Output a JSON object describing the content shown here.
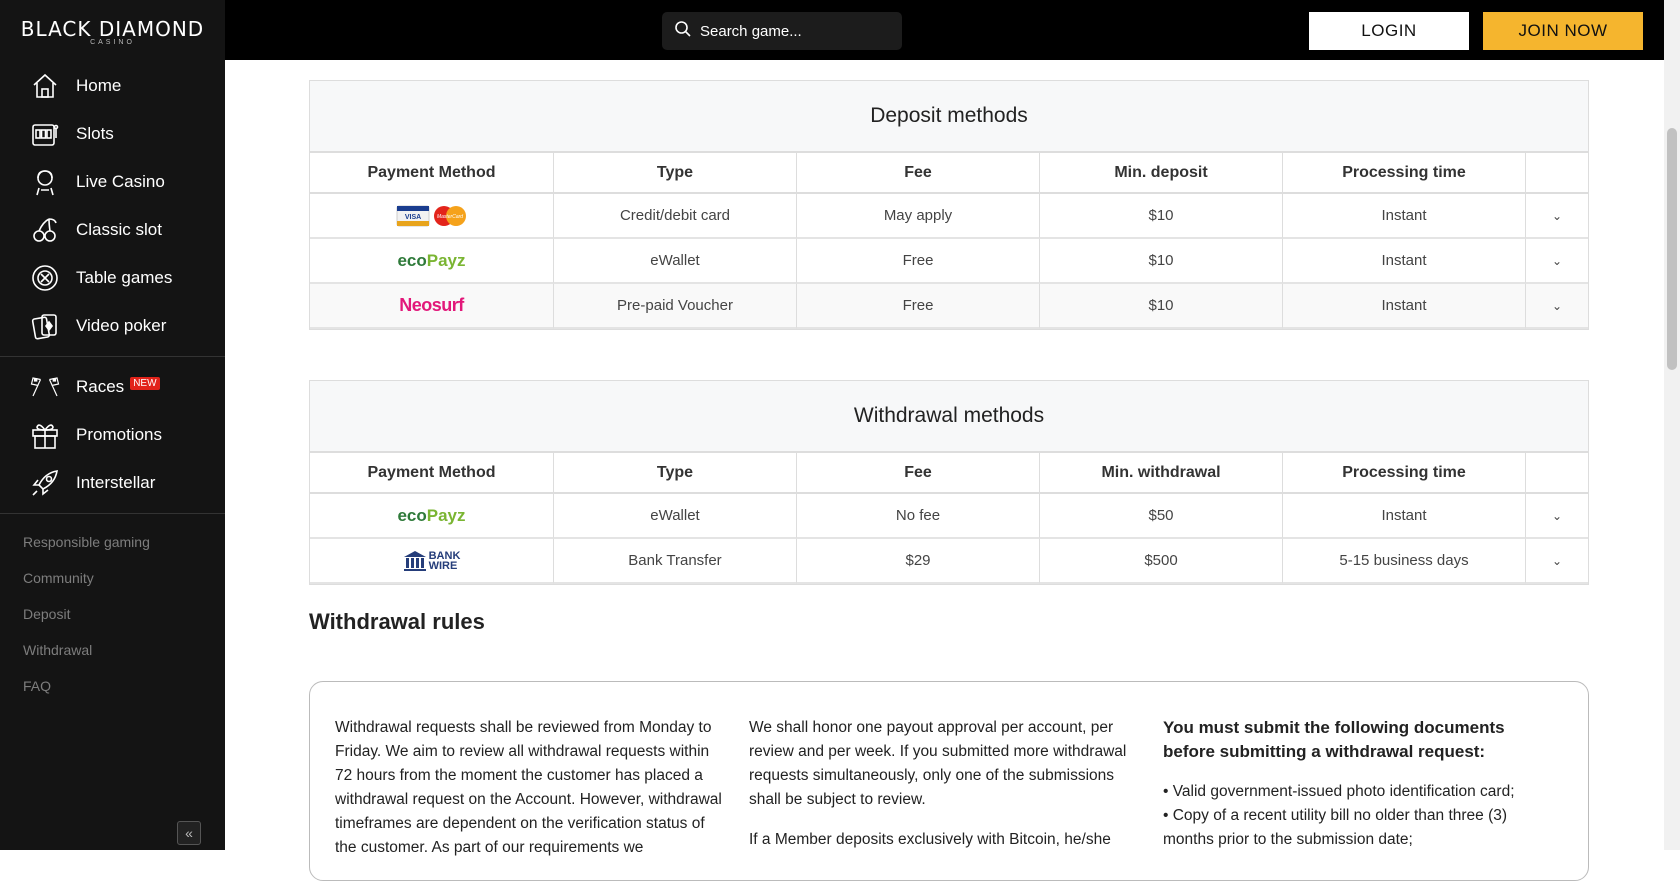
{
  "brand": {
    "name": "BLACK DIAMOND",
    "tagline": "CASINO"
  },
  "search": {
    "placeholder": "Search game..."
  },
  "header": {
    "login_label": "LOGIN",
    "join_label": "JOIN NOW"
  },
  "sidebar": {
    "items": [
      {
        "label": "Home",
        "icon": "home-icon"
      },
      {
        "label": "Slots",
        "icon": "slots-icon"
      },
      {
        "label": "Live Casino",
        "icon": "live-dealer-icon"
      },
      {
        "label": "Classic slot",
        "icon": "cherry-icon"
      },
      {
        "label": "Table games",
        "icon": "roulette-icon"
      },
      {
        "label": "Video poker",
        "icon": "cards-icon"
      }
    ],
    "items2": [
      {
        "label": "Races",
        "icon": "race-flags-icon",
        "badge": "NEW"
      },
      {
        "label": "Promotions",
        "icon": "gift-icon"
      },
      {
        "label": "Interstellar",
        "icon": "rocket-icon"
      }
    ],
    "links": [
      "Responsible gaming",
      "Community",
      "Deposit",
      "Withdrawal",
      "FAQ"
    ],
    "collapse_glyph": "«"
  },
  "deposit": {
    "title": "Deposit methods",
    "headers": [
      "Payment Method",
      "Type",
      "Fee",
      "Min. deposit",
      "Processing time"
    ],
    "rows": [
      {
        "method": "Visa / MasterCard",
        "type": "Credit/debit card",
        "fee": "May apply",
        "min": "$10",
        "time": "Instant"
      },
      {
        "method": "ecoPayz",
        "type": "eWallet",
        "fee": "Free",
        "min": "$10",
        "time": "Instant"
      },
      {
        "method": "Neosurf",
        "type": "Pre-paid Voucher",
        "fee": "Free",
        "min": "$10",
        "time": "Instant"
      }
    ]
  },
  "withdrawal": {
    "title": "Withdrawal methods",
    "headers": [
      "Payment Method",
      "Type",
      "Fee",
      "Min. withdrawal",
      "Processing time"
    ],
    "rows": [
      {
        "method": "ecoPayz",
        "type": "eWallet",
        "fee": "No fee",
        "min": "$50",
        "time": "Instant"
      },
      {
        "method": "Bank Wire",
        "type": "Bank Transfer",
        "fee": "$29",
        "min": "$500",
        "time": "5-15 business days"
      }
    ]
  },
  "logos": {
    "eco": "eco",
    "payz": "Payz",
    "neosurf": "Neosurf",
    "bank_line1": "BANK",
    "bank_line2": "WIRE",
    "visa": "VISA",
    "mastercard": "MasterCard"
  },
  "rules": {
    "title": "Withdrawal rules",
    "col1": "Withdrawal requests shall be reviewed from Monday to Friday. We aim to review all withdrawal requests within 72 hours from the moment the customer has placed a withdrawal request on the Account. However, withdrawal timeframes are dependent on the verification status of the customer. As part of our requirements we",
    "col2_p1": "We shall honor one payout approval per account, per review and per week. If you submitted more withdrawal requests simultaneously, only one of the submissions shall be subject to review.",
    "col2_p2": "If a Member deposits exclusively with Bitcoin, he/she",
    "col3_heading": "You must submit the following documents before submitting a withdrawal request:",
    "col3_item1": "• Valid government-issued photo identification card;",
    "col3_item2": "• Copy of a recent utility bill no older than three (3) months prior to the submission date;"
  },
  "colors": {
    "join": "#f5b52e",
    "sidebar": "#141414",
    "header": "#000000"
  }
}
